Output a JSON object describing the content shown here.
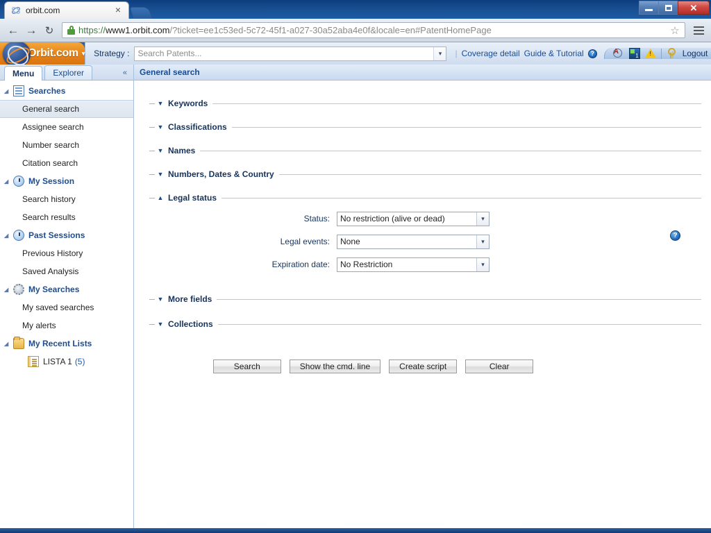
{
  "browser": {
    "tab": {
      "title": "orbit.com",
      "favicon": "orbit-favicon",
      "close": "×"
    },
    "new_tab_label": "",
    "nav": {
      "back": "←",
      "forward": "→",
      "reload": "↻"
    },
    "url": {
      "scheme": "https://",
      "host": "www1.orbit.com",
      "rest": "/?ticket=ee1c53ed-5c72-45f1-a027-30a52aba4e0f&locale=en#PatentHomePage",
      "full": "https://www1.orbit.com/?ticket=ee1c53ed-5c72-45f1-a027-30a52aba4e0f&locale=en#PatentHomePage"
    },
    "bookmark_star": "☆",
    "window_controls": {
      "minimize": "",
      "maximize": "",
      "close": "✕"
    }
  },
  "app": {
    "brand": "Orbit.com",
    "brand_caret": "▾",
    "strategy": {
      "label": "Strategy :",
      "placeholder": "Search Patents...",
      "value": "",
      "arrow": "▾"
    },
    "header_links": {
      "coverage": "Coverage detail",
      "guide": "Guide & Tutorial",
      "help": "?"
    },
    "header_right": {
      "icons": [
        "font-search-icon",
        "translate-icon",
        "alert-warning-icon",
        "key-icon"
      ],
      "logout": "Logout"
    }
  },
  "sidebar": {
    "tabs": [
      {
        "label": "Menu",
        "active": true
      },
      {
        "label": "Explorer",
        "active": false
      }
    ],
    "collapse": "«",
    "groups": [
      {
        "label": "Searches",
        "icon": "doc",
        "twisty": "◢",
        "items": [
          {
            "label": "General search",
            "selected": true
          },
          {
            "label": "Assignee search",
            "selected": false
          },
          {
            "label": "Number search",
            "selected": false
          },
          {
            "label": "Citation search",
            "selected": false
          }
        ]
      },
      {
        "label": "My Session",
        "icon": "clock",
        "twisty": "◢",
        "items": [
          {
            "label": "Search history",
            "selected": false
          },
          {
            "label": "Search results",
            "selected": false
          }
        ]
      },
      {
        "label": "Past Sessions",
        "icon": "clock",
        "twisty": "◢",
        "items": [
          {
            "label": "Previous History",
            "selected": false
          },
          {
            "label": "Saved Analysis",
            "selected": false
          }
        ]
      },
      {
        "label": "My Searches",
        "icon": "gear",
        "twisty": "◢",
        "items": [
          {
            "label": "My saved searches",
            "selected": false
          },
          {
            "label": "My alerts",
            "selected": false
          }
        ]
      },
      {
        "label": "My Recent Lists",
        "icon": "folder",
        "twisty": "◢",
        "items": [
          {
            "label": "LISTA 1",
            "count": "(5)",
            "sub": true,
            "selected": false
          }
        ]
      }
    ]
  },
  "main": {
    "title": "General search",
    "sections": [
      {
        "label": "Keywords",
        "expanded": false,
        "arrow": "▼"
      },
      {
        "label": "Classifications",
        "expanded": false,
        "arrow": "▼"
      },
      {
        "label": "Names",
        "expanded": false,
        "arrow": "▼"
      },
      {
        "label": "Numbers, Dates & Country",
        "expanded": false,
        "arrow": "▼"
      },
      {
        "label": "Legal status",
        "expanded": true,
        "arrow": "▲"
      },
      {
        "label": "More fields",
        "expanded": false,
        "arrow": "▼"
      },
      {
        "label": "Collections",
        "expanded": false,
        "arrow": "▼"
      }
    ],
    "legal_status": {
      "help": "?",
      "fields": [
        {
          "label": "Status:",
          "value": "No restriction (alive or dead)",
          "arrow": "▾"
        },
        {
          "label": "Legal events:",
          "value": "None",
          "arrow": "▾"
        },
        {
          "label": "Expiration date:",
          "value": "No Restriction",
          "arrow": "▾"
        }
      ]
    },
    "buttons": [
      {
        "label": "Search"
      },
      {
        "label": "Show the cmd. line"
      },
      {
        "label": "Create script"
      },
      {
        "label": "Clear"
      }
    ]
  },
  "colors": {
    "brand_orange": "#e8871c",
    "header_blue": "#23528f",
    "link_blue": "#1a4b93",
    "section_label": "#16335c",
    "selected_row": "#e3eaf3"
  }
}
